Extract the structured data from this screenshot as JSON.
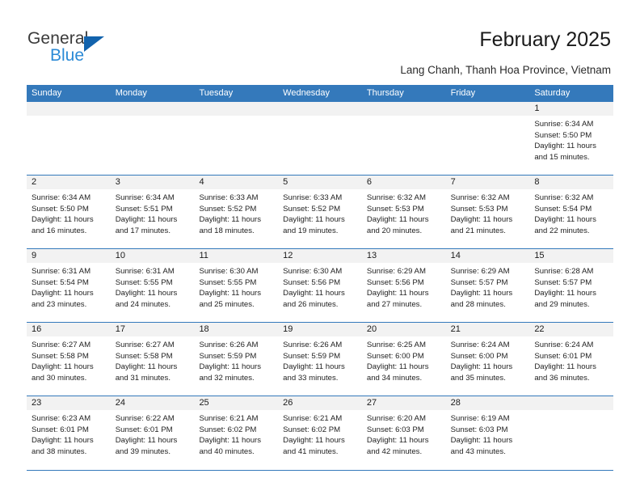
{
  "brand": {
    "name_top": "General",
    "name_bottom": "Blue",
    "accent_color": "#2b8ad6",
    "triangle_color": "#1263ad"
  },
  "header": {
    "title": "February 2025",
    "subtitle": "Lang Chanh, Thanh Hoa Province, Vietnam"
  },
  "calendar": {
    "header_background": "#3479bb",
    "header_text_color": "#ffffff",
    "daynumber_band_color": "#f2f2f2",
    "weekday_headers": [
      "Sunday",
      "Monday",
      "Tuesday",
      "Wednesday",
      "Thursday",
      "Friday",
      "Saturday"
    ],
    "weeks": [
      [
        {
          "day": "",
          "sunrise": "",
          "sunset": "",
          "daylight": "",
          "empty": true
        },
        {
          "day": "",
          "sunrise": "",
          "sunset": "",
          "daylight": "",
          "empty": true
        },
        {
          "day": "",
          "sunrise": "",
          "sunset": "",
          "daylight": "",
          "empty": true
        },
        {
          "day": "",
          "sunrise": "",
          "sunset": "",
          "daylight": "",
          "empty": true
        },
        {
          "day": "",
          "sunrise": "",
          "sunset": "",
          "daylight": "",
          "empty": true
        },
        {
          "day": "",
          "sunrise": "",
          "sunset": "",
          "daylight": "",
          "empty": true
        },
        {
          "day": "1",
          "sunrise": "Sunrise: 6:34 AM",
          "sunset": "Sunset: 5:50 PM",
          "daylight": "Daylight: 11 hours and 15 minutes.",
          "empty": false
        }
      ],
      [
        {
          "day": "2",
          "sunrise": "Sunrise: 6:34 AM",
          "sunset": "Sunset: 5:50 PM",
          "daylight": "Daylight: 11 hours and 16 minutes.",
          "empty": false
        },
        {
          "day": "3",
          "sunrise": "Sunrise: 6:34 AM",
          "sunset": "Sunset: 5:51 PM",
          "daylight": "Daylight: 11 hours and 17 minutes.",
          "empty": false
        },
        {
          "day": "4",
          "sunrise": "Sunrise: 6:33 AM",
          "sunset": "Sunset: 5:52 PM",
          "daylight": "Daylight: 11 hours and 18 minutes.",
          "empty": false
        },
        {
          "day": "5",
          "sunrise": "Sunrise: 6:33 AM",
          "sunset": "Sunset: 5:52 PM",
          "daylight": "Daylight: 11 hours and 19 minutes.",
          "empty": false
        },
        {
          "day": "6",
          "sunrise": "Sunrise: 6:32 AM",
          "sunset": "Sunset: 5:53 PM",
          "daylight": "Daylight: 11 hours and 20 minutes.",
          "empty": false
        },
        {
          "day": "7",
          "sunrise": "Sunrise: 6:32 AM",
          "sunset": "Sunset: 5:53 PM",
          "daylight": "Daylight: 11 hours and 21 minutes.",
          "empty": false
        },
        {
          "day": "8",
          "sunrise": "Sunrise: 6:32 AM",
          "sunset": "Sunset: 5:54 PM",
          "daylight": "Daylight: 11 hours and 22 minutes.",
          "empty": false
        }
      ],
      [
        {
          "day": "9",
          "sunrise": "Sunrise: 6:31 AM",
          "sunset": "Sunset: 5:54 PM",
          "daylight": "Daylight: 11 hours and 23 minutes.",
          "empty": false
        },
        {
          "day": "10",
          "sunrise": "Sunrise: 6:31 AM",
          "sunset": "Sunset: 5:55 PM",
          "daylight": "Daylight: 11 hours and 24 minutes.",
          "empty": false
        },
        {
          "day": "11",
          "sunrise": "Sunrise: 6:30 AM",
          "sunset": "Sunset: 5:55 PM",
          "daylight": "Daylight: 11 hours and 25 minutes.",
          "empty": false
        },
        {
          "day": "12",
          "sunrise": "Sunrise: 6:30 AM",
          "sunset": "Sunset: 5:56 PM",
          "daylight": "Daylight: 11 hours and 26 minutes.",
          "empty": false
        },
        {
          "day": "13",
          "sunrise": "Sunrise: 6:29 AM",
          "sunset": "Sunset: 5:56 PM",
          "daylight": "Daylight: 11 hours and 27 minutes.",
          "empty": false
        },
        {
          "day": "14",
          "sunrise": "Sunrise: 6:29 AM",
          "sunset": "Sunset: 5:57 PM",
          "daylight": "Daylight: 11 hours and 28 minutes.",
          "empty": false
        },
        {
          "day": "15",
          "sunrise": "Sunrise: 6:28 AM",
          "sunset": "Sunset: 5:57 PM",
          "daylight": "Daylight: 11 hours and 29 minutes.",
          "empty": false
        }
      ],
      [
        {
          "day": "16",
          "sunrise": "Sunrise: 6:27 AM",
          "sunset": "Sunset: 5:58 PM",
          "daylight": "Daylight: 11 hours and 30 minutes.",
          "empty": false
        },
        {
          "day": "17",
          "sunrise": "Sunrise: 6:27 AM",
          "sunset": "Sunset: 5:58 PM",
          "daylight": "Daylight: 11 hours and 31 minutes.",
          "empty": false
        },
        {
          "day": "18",
          "sunrise": "Sunrise: 6:26 AM",
          "sunset": "Sunset: 5:59 PM",
          "daylight": "Daylight: 11 hours and 32 minutes.",
          "empty": false
        },
        {
          "day": "19",
          "sunrise": "Sunrise: 6:26 AM",
          "sunset": "Sunset: 5:59 PM",
          "daylight": "Daylight: 11 hours and 33 minutes.",
          "empty": false
        },
        {
          "day": "20",
          "sunrise": "Sunrise: 6:25 AM",
          "sunset": "Sunset: 6:00 PM",
          "daylight": "Daylight: 11 hours and 34 minutes.",
          "empty": false
        },
        {
          "day": "21",
          "sunrise": "Sunrise: 6:24 AM",
          "sunset": "Sunset: 6:00 PM",
          "daylight": "Daylight: 11 hours and 35 minutes.",
          "empty": false
        },
        {
          "day": "22",
          "sunrise": "Sunrise: 6:24 AM",
          "sunset": "Sunset: 6:01 PM",
          "daylight": "Daylight: 11 hours and 36 minutes.",
          "empty": false
        }
      ],
      [
        {
          "day": "23",
          "sunrise": "Sunrise: 6:23 AM",
          "sunset": "Sunset: 6:01 PM",
          "daylight": "Daylight: 11 hours and 38 minutes.",
          "empty": false
        },
        {
          "day": "24",
          "sunrise": "Sunrise: 6:22 AM",
          "sunset": "Sunset: 6:01 PM",
          "daylight": "Daylight: 11 hours and 39 minutes.",
          "empty": false
        },
        {
          "day": "25",
          "sunrise": "Sunrise: 6:21 AM",
          "sunset": "Sunset: 6:02 PM",
          "daylight": "Daylight: 11 hours and 40 minutes.",
          "empty": false
        },
        {
          "day": "26",
          "sunrise": "Sunrise: 6:21 AM",
          "sunset": "Sunset: 6:02 PM",
          "daylight": "Daylight: 11 hours and 41 minutes.",
          "empty": false
        },
        {
          "day": "27",
          "sunrise": "Sunrise: 6:20 AM",
          "sunset": "Sunset: 6:03 PM",
          "daylight": "Daylight: 11 hours and 42 minutes.",
          "empty": false
        },
        {
          "day": "28",
          "sunrise": "Sunrise: 6:19 AM",
          "sunset": "Sunset: 6:03 PM",
          "daylight": "Daylight: 11 hours and 43 minutes.",
          "empty": false
        },
        {
          "day": "",
          "sunrise": "",
          "sunset": "",
          "daylight": "",
          "empty": true
        }
      ]
    ]
  }
}
